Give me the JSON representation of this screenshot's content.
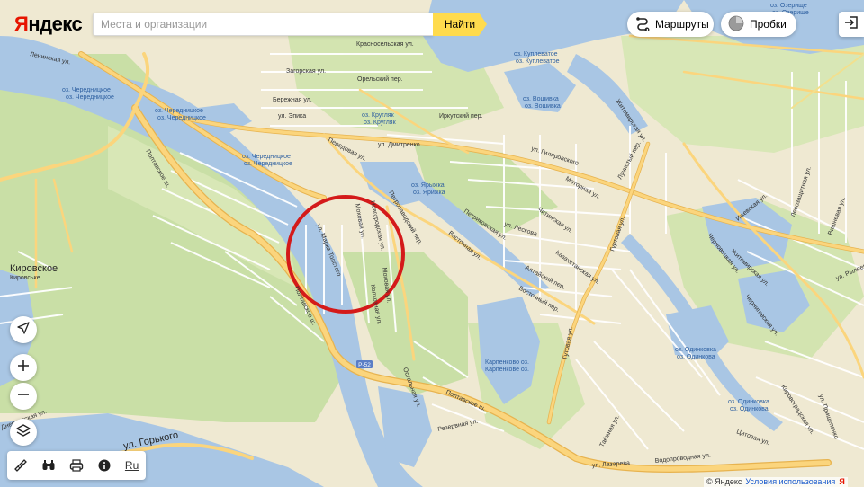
{
  "brand": {
    "logo_text": "Яндекс"
  },
  "search": {
    "placeholder": "Места и организации",
    "button_label": "Найти"
  },
  "header": {
    "routes_label": "Маршруты",
    "traffic_label": "Пробки"
  },
  "bottom_tools": {
    "language": "Ru"
  },
  "footer": {
    "copyright": "© Яндекс",
    "terms": "Условия использования",
    "logo_mark": "Я"
  },
  "colors": {
    "water": "#a9c6e4",
    "land": "#efe9d2",
    "green": "#c9dfa6",
    "road_main": "#f9c96a",
    "highlight_circle": "#d41a1a"
  },
  "map": {
    "places": {
      "kirovskoe": "Кировское",
      "kirovske": "Кировське"
    },
    "highways": {
      "r52": "Р-52"
    },
    "streets": {
      "leninskaya": "Ленинская ул.",
      "zagorskaya": "Загорская ул.",
      "krasnoselskaya": "Красносельская ул.",
      "orelsky": "Орельский пер.",
      "berezhnaya": "Бережная ул.",
      "epika": "ул. Эпика",
      "irkutsky": "Иркутский пер.",
      "gilyarovskogo": "ул. Гиляровского",
      "peredovaya": "Передовая ул.",
      "dmitrenko": "ул. Дмитренко",
      "poltavskoe_1": "Полтавское ш.",
      "poltavskoe_2": "Полтавское ш.",
      "poltavskoe_3": "Полтавское ш.",
      "marka_tolstogo": "ул. Марка Толстого",
      "mokhovaya": "Моховая ул.",
      "novgorodskaya": "Новгородская ул.",
      "petrozavodsky": "Петрозаводский пер.",
      "mokhovaya_2": "Моховая ул.",
      "kolkhoznaya": "Колхозная ул.",
      "petrikovskaya": "Петриковская ул.",
      "leskova": "ул. Лескова",
      "chitinskaya": "Читинская ул.",
      "motornaya": "Моторная ул.",
      "gutovaya": "Гутовая ул.",
      "guptovaya": "Гуртовая ул.",
      "luchisty": "Лучистый пер.",
      "zhitomirskaya": "Житомирская ул.",
      "vostochnaya": "Восточная ул.",
      "vostochny": "Восточный пер.",
      "altaisky": "Алтайский пер.",
      "kazakhstanskaya": "Казахстанская ул.",
      "ostalnaya": "Остальная ул.",
      "rezervnaya": "Резервная ул.",
      "taezhnaya": "Таёжная ул.",
      "gorkogo": "ул. Горького",
      "lazareva": "ул. Лазарева",
      "vodoprovodnaya": "Водопроводная ул.",
      "tsiotovaya": "Цитовая ул.",
      "kirovogradskaya": "Кировоградская ул.",
      "prishchepenko": "ул. Прищепенко",
      "chernivetskaya": "Черновецкая ул.",
      "zhitomirskaya_2": "Житомирская ул.",
      "izhevskaya": "Ижевская ул.",
      "vishnevaya": "Вишневая ул.",
      "lesozashchitnaya": "Лесозащитная ул.",
      "ryleeva": "ул. Рылеева",
      "chernigovskaya": "Черниговская ул.",
      "dneprovskaya": "Днепровская ул."
    },
    "water": {
      "cherednichki_1": "оз. Чередницкое",
      "cherednichki_1b": "оз. Чередницкое",
      "cherednichki_2": "оз. Чередницкое",
      "cherednichki_2b": "оз. Чередницкое",
      "cherednichki_3": "оз. Чередницкое",
      "cherednichki_3b": "оз. Чередницкое",
      "kruglyak": "оз. Кругляк",
      "kruglyak_b": "оз. Кругляк",
      "kuplevatoe": "оз. Куплеватое",
      "kuplevatoe_b": "оз. Куплеватое",
      "voshivka": "оз. Вошивка",
      "voshivka_b": "оз. Вошивка",
      "yaryzhka": "оз. Ярыжка",
      "yaryzhka_b": "оз. Ярижка",
      "karpenkovo": "Карпенково оз.",
      "karpenkovo_b": "Карпенкове оз.",
      "odinkovka": "оз. Одинковка",
      "odinkovka_b": "оз. Одинкова",
      "odinkovka_2": "оз. Одинковка",
      "odinkovka_2b": "оз. Одинкова",
      "ozerishche": "оз. Озерище",
      "ozerishche_b": "оз. Озерище"
    }
  }
}
